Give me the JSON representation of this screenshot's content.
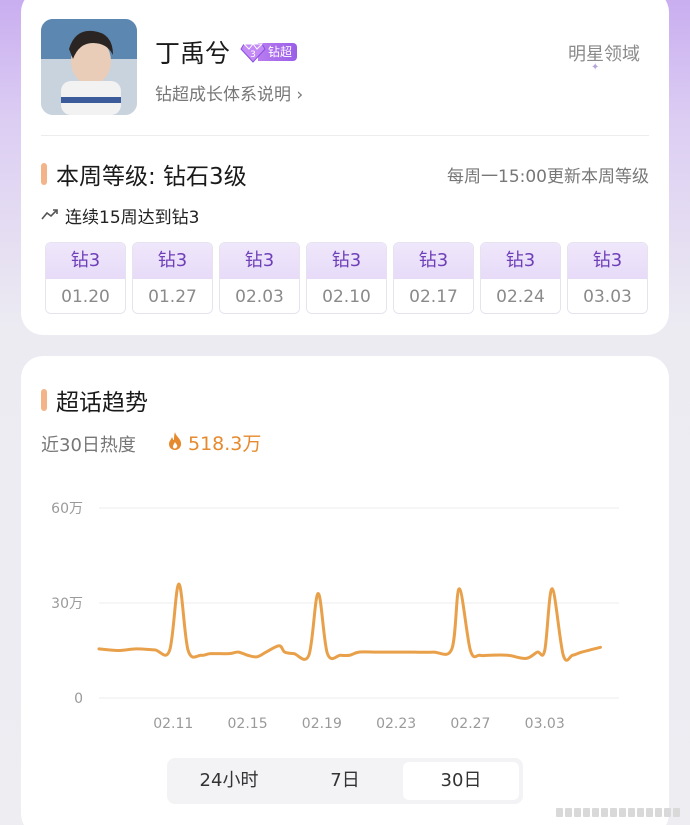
{
  "profile": {
    "name": "丁禹兮",
    "badge_label": "钻超",
    "growth_link": "钻超成长体系说明 ›",
    "realm_label": "明星领域"
  },
  "level": {
    "title": "本周等级: 钻石3级",
    "update_note": "每周一15:00更新本周等级",
    "streak": "连续15周达到钻3",
    "weeks": [
      {
        "level": "钻3",
        "date": "01.20"
      },
      {
        "level": "钻3",
        "date": "01.27"
      },
      {
        "level": "钻3",
        "date": "02.03"
      },
      {
        "level": "钻3",
        "date": "02.10"
      },
      {
        "level": "钻3",
        "date": "02.17"
      },
      {
        "level": "钻3",
        "date": "02.24"
      },
      {
        "level": "钻3",
        "date": "03.03"
      }
    ]
  },
  "trend": {
    "title": "超话趋势",
    "heat_label": "近30日热度",
    "heat_value": "518.3万",
    "range_options": [
      "24小时",
      "7日",
      "30日"
    ],
    "active_range": "30日"
  },
  "colors": {
    "accent_orange": "#e58a2e",
    "line": "#e9a04a",
    "badge_purple": "#9a5ee8",
    "level_purple": "#6e3fb8"
  },
  "chart_data": {
    "type": "line",
    "y_tick_labels": [
      "60万",
      "30万",
      "0"
    ],
    "y_ticks": [
      60,
      30,
      0
    ],
    "ylim": [
      0,
      60
    ],
    "x_tick_labels": [
      "02.11",
      "02.15",
      "02.19",
      "02.23",
      "02.27",
      "03.03"
    ],
    "x_ticks": [
      3,
      7,
      11,
      15,
      19,
      23
    ],
    "xlim": [
      -1,
      27
    ],
    "grid": true,
    "series": [
      {
        "values_x": [
          -1,
          0,
          1,
          2,
          2.8,
          3.3,
          3.8,
          4.5,
          5,
          6,
          6.5,
          7,
          7.5,
          8,
          8.7,
          9,
          9.5,
          10.3,
          10.8,
          11.3,
          12,
          12.5,
          13,
          14,
          15,
          16,
          17,
          18,
          18.4,
          19,
          19.5,
          20,
          21,
          22,
          22.6,
          23,
          23.4,
          24,
          24.5,
          25,
          26
        ],
        "values_y": [
          15.5,
          15,
          15.5,
          15.2,
          15,
          36,
          15,
          13.5,
          14,
          14,
          14.5,
          13.5,
          13,
          14.5,
          16.5,
          14.5,
          14,
          13.5,
          33,
          14,
          13.5,
          13.5,
          14.5,
          14.5,
          14.5,
          14.5,
          14.5,
          15.5,
          34.5,
          15,
          13.5,
          13.5,
          13.5,
          12.5,
          14.5,
          15,
          34.5,
          13.5,
          13.5,
          14.5,
          16
        ]
      }
    ]
  }
}
